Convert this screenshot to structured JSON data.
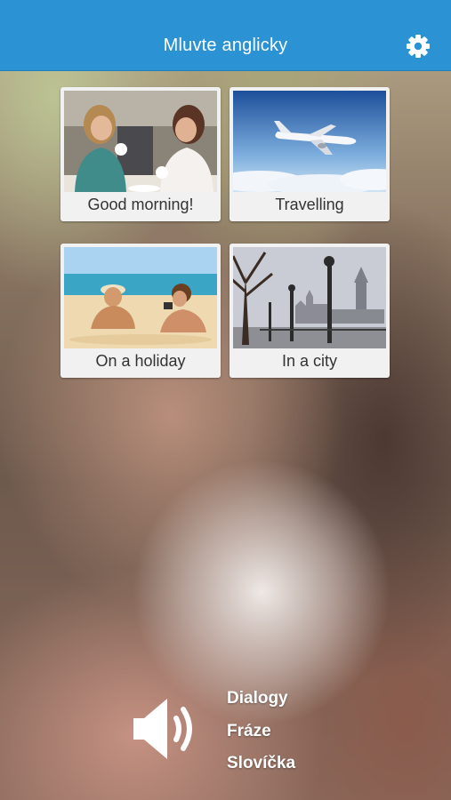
{
  "header": {
    "title": "Mluvte anglicky",
    "settings_icon": "gear-icon",
    "background_color": "#2b92d4"
  },
  "categories": [
    {
      "label": "Good morning!",
      "image": "two-women-having-coffee"
    },
    {
      "label": "Travelling",
      "image": "airplane-above-clouds"
    },
    {
      "label": "On a holiday",
      "image": "couple-on-beach"
    },
    {
      "label": "In a city",
      "image": "london-westminster-riverside"
    }
  ],
  "audio": {
    "icon": "speaker-icon"
  },
  "menu": {
    "items": [
      "Dialogy",
      "Fráze",
      "Slovíčka"
    ]
  }
}
